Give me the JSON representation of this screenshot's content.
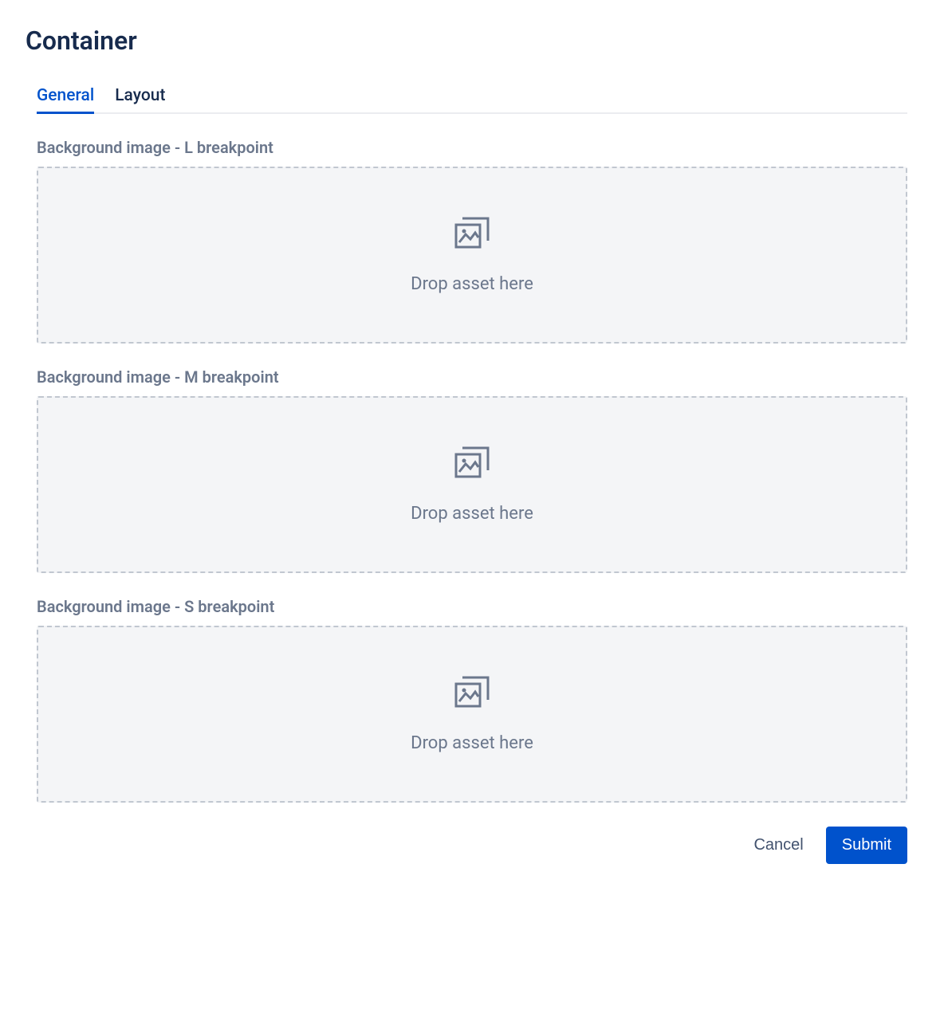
{
  "title": "Container",
  "tabs": [
    {
      "label": "General",
      "active": true
    },
    {
      "label": "Layout",
      "active": false
    }
  ],
  "fields": [
    {
      "label": "Background image - L breakpoint",
      "placeholder": "Drop asset here"
    },
    {
      "label": "Background image - M breakpoint",
      "placeholder": "Drop asset here"
    },
    {
      "label": "Background image - S breakpoint",
      "placeholder": "Drop asset here"
    }
  ],
  "buttons": {
    "cancel": "Cancel",
    "submit": "Submit"
  }
}
